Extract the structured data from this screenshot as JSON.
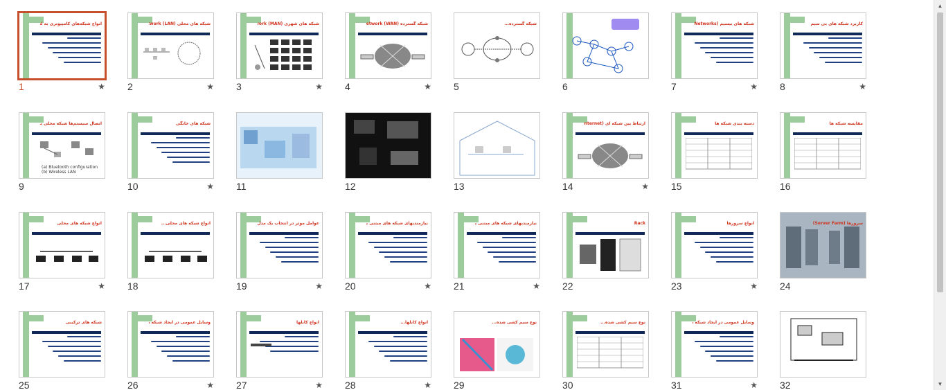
{
  "slides": [
    {
      "n": "1",
      "title": "انواع شبکه‌های کامپیوتری به لحاظ وسعت",
      "star": true,
      "selected": true,
      "kind": "text"
    },
    {
      "n": "2",
      "title": "شبکه های محلی (LAN) Local Area Network",
      "star": true,
      "kind": "ring"
    },
    {
      "n": "3",
      "title": "شبکه های شهری (MAN) Metropolitan Area Network",
      "star": true,
      "kind": "grid"
    },
    {
      "n": "4",
      "title": "شبکه گسترده (WAN) Wide Area Network",
      "star": true,
      "kind": "cloud"
    },
    {
      "n": "5",
      "title": "شبکه گسترده...",
      "star": false,
      "kind": "router"
    },
    {
      "n": "6",
      "title": "",
      "star": false,
      "kind": "nodes"
    },
    {
      "n": "7",
      "title": "شبکه های بیسیم (Wireless Networks)",
      "star": true,
      "kind": "text"
    },
    {
      "n": "8",
      "title": "کاربرد شبکه های بی سیم",
      "star": true,
      "kind": "text"
    },
    {
      "n": "9",
      "title": "اتصال سیستم‌ها شبکه محلی بیسیم",
      "star": false,
      "kind": "wifi",
      "caption": "(a) Bluetooth configuration  (b) Wireless LAN"
    },
    {
      "n": "10",
      "title": "شبکه های خانگی",
      "star": true,
      "kind": "text"
    },
    {
      "n": "11",
      "title": "",
      "star": false,
      "kind": "photo-blue"
    },
    {
      "n": "12",
      "title": "",
      "star": false,
      "kind": "photo-dark"
    },
    {
      "n": "13",
      "title": "",
      "star": false,
      "kind": "house"
    },
    {
      "n": "14",
      "title": "ارتباط بین شبکه ای (Internet)",
      "star": true,
      "kind": "cloud"
    },
    {
      "n": "15",
      "title": "دسته بندی شبکه ها",
      "star": false,
      "kind": "table"
    },
    {
      "n": "16",
      "title": "مقایسه شبکه ها",
      "star": false,
      "kind": "table"
    },
    {
      "n": "17",
      "title": "انواع شبکه های محلی",
      "star": true,
      "kind": "pcs"
    },
    {
      "n": "18",
      "title": "انواع شبکه های محلی...",
      "star": false,
      "kind": "pcs"
    },
    {
      "n": "19",
      "title": "عوامل موثر در انتخاب یک مدل خاص",
      "star": true,
      "kind": "text"
    },
    {
      "n": "20",
      "title": "نیازمندیهای شبکه های مبتنی بر سرور",
      "star": true,
      "kind": "text"
    },
    {
      "n": "21",
      "title": "نیازمندیهای شبکه های مبتنی بر سرور...",
      "star": true,
      "kind": "text"
    },
    {
      "n": "22",
      "title": "Rack",
      "star": false,
      "kind": "rack"
    },
    {
      "n": "23",
      "title": "انواع سرورها",
      "star": true,
      "kind": "text"
    },
    {
      "n": "24",
      "title": "سرورها (Server Farm)",
      "star": false,
      "kind": "photo-farm"
    },
    {
      "n": "25",
      "title": "شبکه های ترکیبی",
      "star": false,
      "kind": "text"
    },
    {
      "n": "26",
      "title": "وسایل عمومی در ایجاد شبکه های محلی",
      "star": true,
      "kind": "text"
    },
    {
      "n": "27",
      "title": "انواع کابلها",
      "star": true,
      "kind": "cable"
    },
    {
      "n": "28",
      "title": "انواع کابلها...",
      "star": true,
      "kind": "text"
    },
    {
      "n": "29",
      "title": "نوع سیم کشی شده...",
      "star": false,
      "kind": "rj45"
    },
    {
      "n": "30",
      "title": "نوع سیم کشی شده...",
      "star": false,
      "kind": "table"
    },
    {
      "n": "31",
      "title": "وسایل عمومی در ایجاد شبکه ها",
      "star": true,
      "kind": "text"
    },
    {
      "n": "32",
      "title": "",
      "star": false,
      "kind": "board"
    }
  ],
  "icons": {
    "star": "star-icon",
    "up": "scroll-up-arrow-icon",
    "down": "scroll-down-arrow-icon"
  },
  "glyphs": {
    "star": "★",
    "up": "▲",
    "down": "▼"
  },
  "colors": {
    "accent": "#c7502c",
    "title": "#d0311a",
    "navy": "#0f2a56",
    "green": "#9ccc9c"
  }
}
